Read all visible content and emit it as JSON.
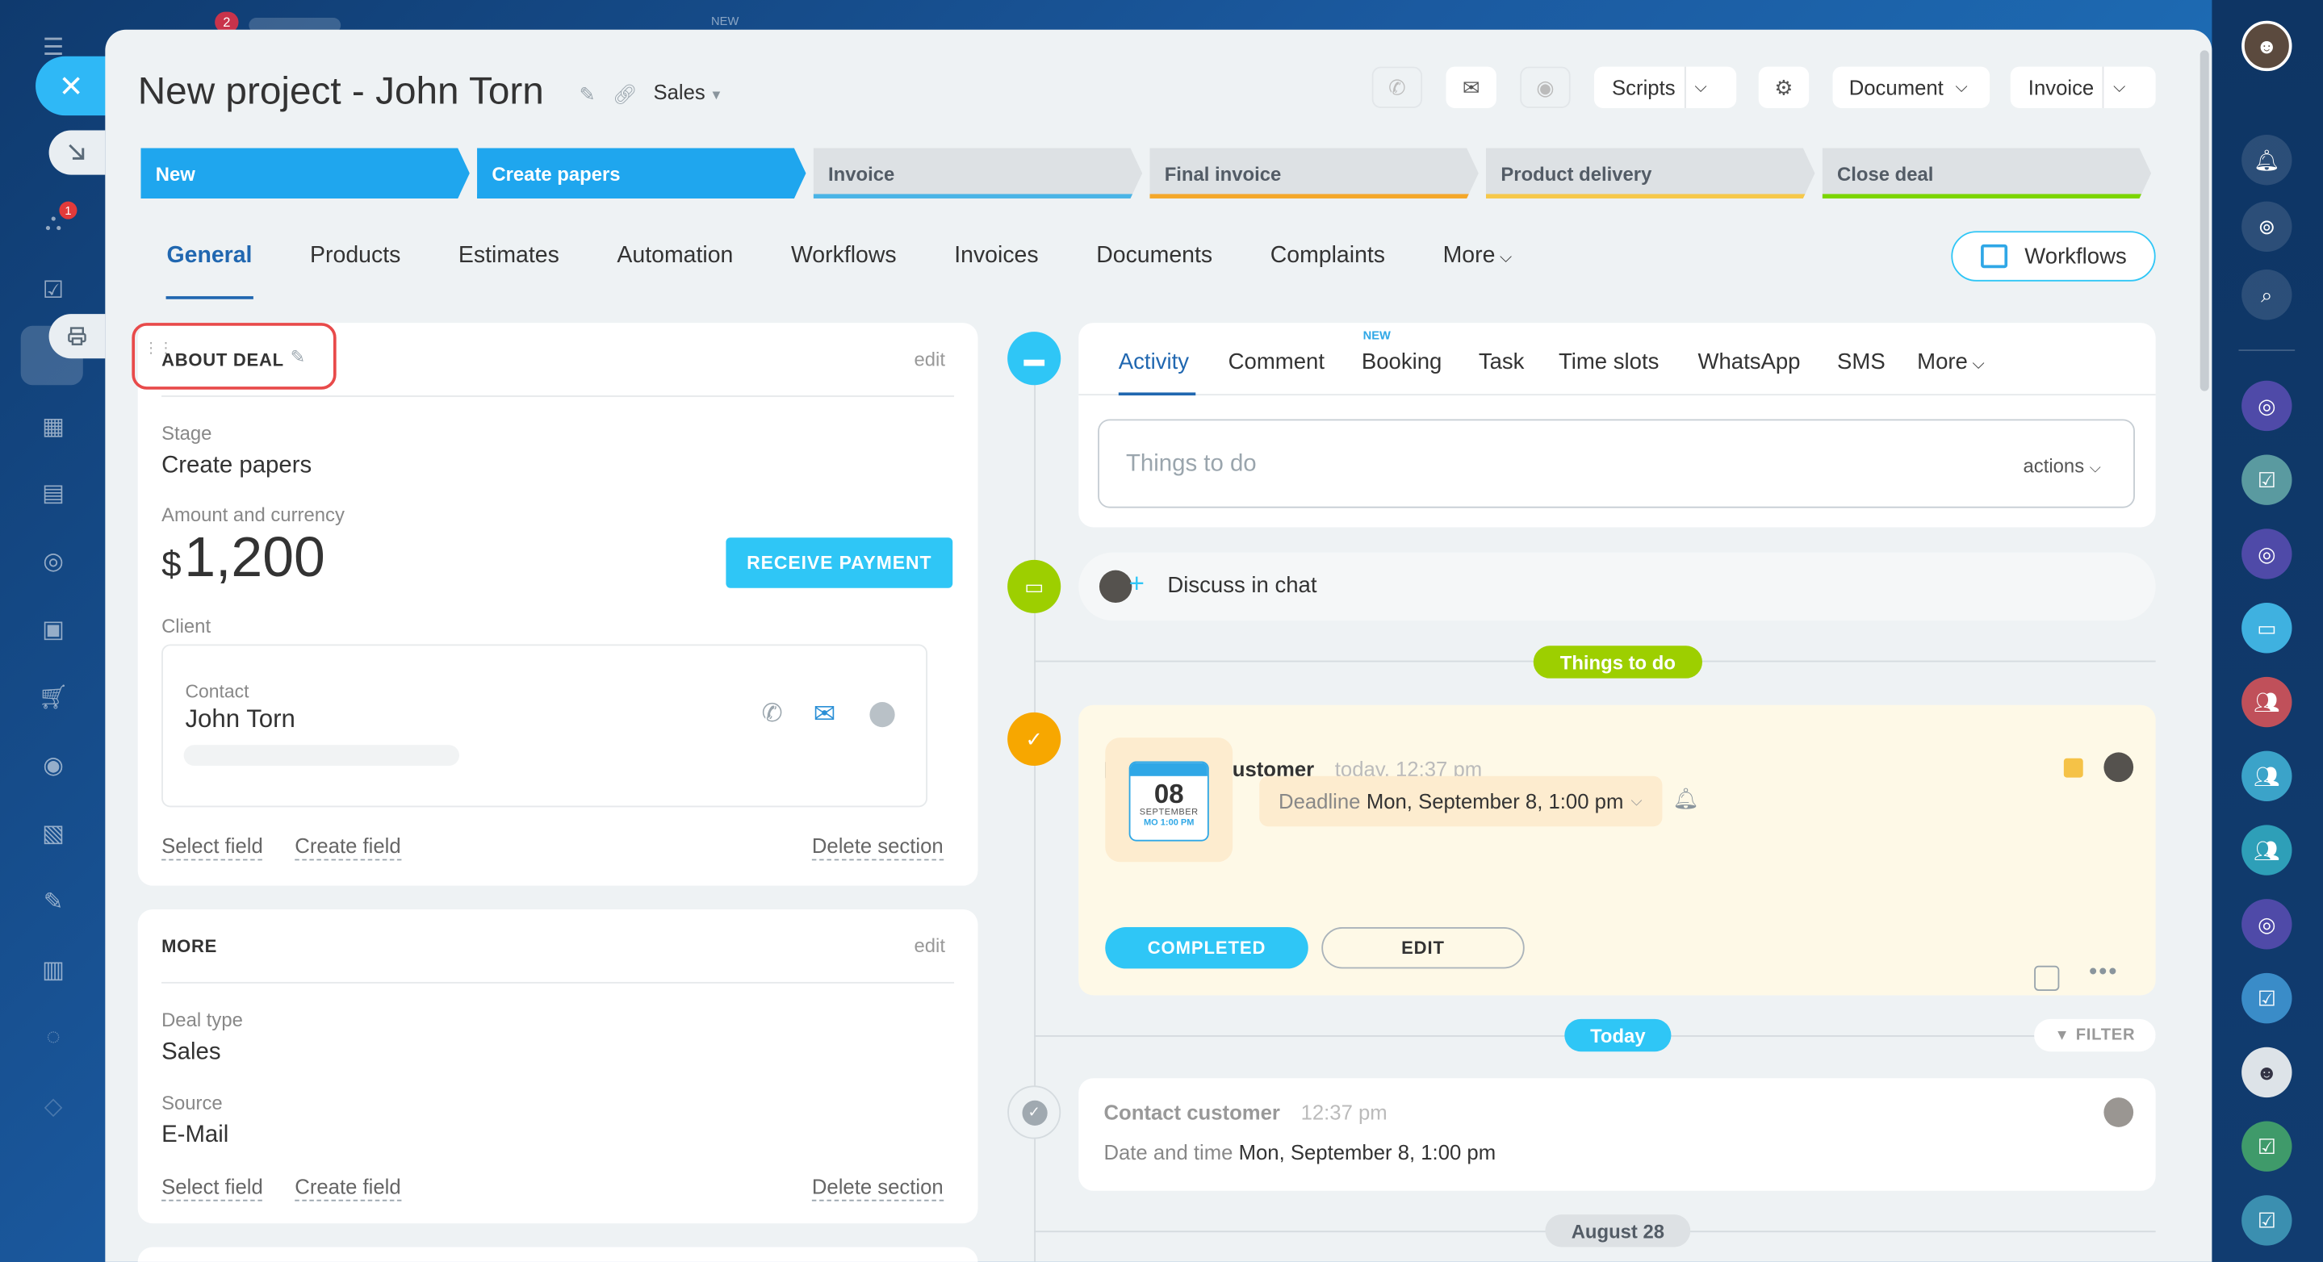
{
  "topbar_badge": "2",
  "topbar_new": "NEW",
  "left_sidebar": {
    "badge": "1"
  },
  "header": {
    "title": "New project - John Torn",
    "category": "Sales",
    "scripts_label": "Scripts",
    "document_label": "Document",
    "invoice_label": "Invoice"
  },
  "pipeline": [
    {
      "label": "New",
      "bg": "#1fa6ee",
      "bar": "#1fa6ee",
      "text": "#ffffff"
    },
    {
      "label": "Create papers",
      "bg": "#1fa6ee",
      "bar": "#1fa6ee",
      "text": "#ffffff"
    },
    {
      "label": "Invoice",
      "bg": "#dde1e4",
      "bar": "#4ab4e6",
      "text": "#535c66"
    },
    {
      "label": "Final invoice",
      "bg": "#dde1e4",
      "bar": "#f4a72a",
      "text": "#535c66"
    },
    {
      "label": "Product delivery",
      "bg": "#dde1e4",
      "bar": "#f6c84a",
      "text": "#535c66"
    },
    {
      "label": "Close deal",
      "bg": "#dde1e4",
      "bar": "#7bd500",
      "text": "#535c66"
    }
  ],
  "tabs": [
    "General",
    "Products",
    "Estimates",
    "Automation",
    "Workflows",
    "Invoices",
    "Documents",
    "Complaints",
    "More"
  ],
  "workflows_button": "Workflows",
  "about_deal": {
    "title": "ABOUT DEAL",
    "edit": "edit",
    "stage_label": "Stage",
    "stage_value": "Create papers",
    "amount_label": "Amount and currency",
    "currency_symbol": "$",
    "amount": "1,200",
    "receive_payment": "RECEIVE PAYMENT",
    "client_label": "Client",
    "contact_label": "Contact",
    "contact_name": "John Torn",
    "select_field": "Select field",
    "create_field": "Create field",
    "delete_section": "Delete section"
  },
  "more_section": {
    "title": "MORE",
    "edit": "edit",
    "deal_type_label": "Deal type",
    "deal_type_value": "Sales",
    "source_label": "Source",
    "source_value": "E-Mail",
    "select_field": "Select field",
    "create_field": "Create field",
    "delete_section": "Delete section"
  },
  "activity": {
    "tabs": [
      "Activity",
      "Comment",
      "Booking",
      "Task",
      "Time slots",
      "WhatsApp",
      "SMS",
      "More"
    ],
    "new_badge": "NEW",
    "placeholder": "Things to do",
    "actions": "actions"
  },
  "discuss": "Discuss in chat",
  "things_to_do_pill": "Things to do",
  "todo": {
    "title": "Contact customer",
    "time": "today, 12:37 pm",
    "cal_day": "08",
    "cal_month": "SEPTEMBER",
    "cal_time": "MO 1:00 PM",
    "deadline_label": "Deadline",
    "deadline_value": "Mon, September 8, 1:00 pm",
    "completed": "COMPLETED",
    "edit": "EDIT"
  },
  "today_pill": "Today",
  "filter": "FILTER",
  "history": {
    "title": "Contact customer",
    "time": "12:37 pm",
    "dt_label": "Date and time",
    "dt_value": "Mon, September 8, 1:00 pm"
  },
  "date_pill": "August 28"
}
